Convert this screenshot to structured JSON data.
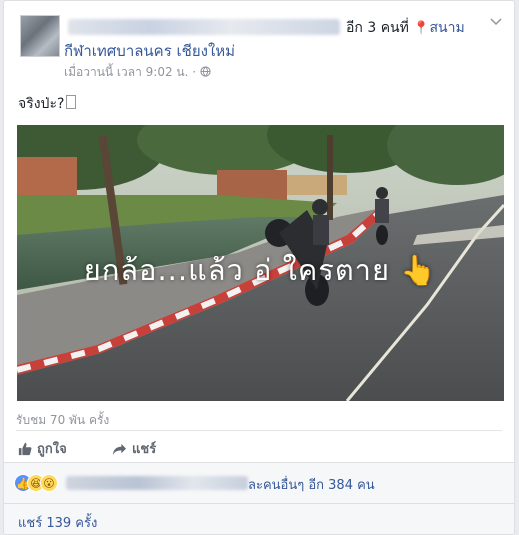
{
  "header": {
    "with_others": "อีก 3 คนที่",
    "location": "สนาม",
    "group": "กีฬาเทศบาลนคร เชียงใหม่",
    "time": "เมื่อวานนี้ เวลา 9:02 น.",
    "time_sep": "·",
    "menu_icon": "chevron-down-icon",
    "privacy_icon": "globe-icon"
  },
  "post": {
    "text": "จริงป่ะ?"
  },
  "video": {
    "caption": "ยกล้อ...แล้ว อ่ ใครตาย",
    "caption_emoji": "👆"
  },
  "stats": {
    "views": "รับชม 70 พัน ครั้ง",
    "reactions_suffix": "ละคนอื่นๆ อีก 384 คน",
    "shares": "แชร์ 139 ครั้ง"
  },
  "actions": {
    "like": "ถูกใจ",
    "share": "แชร์"
  },
  "colors": {
    "link": "#365899",
    "muted": "#90949c",
    "like_blue": "#5890ff",
    "emoji_yellow": "#ffd85c"
  }
}
